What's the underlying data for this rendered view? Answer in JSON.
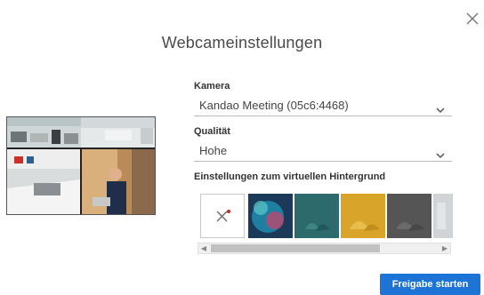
{
  "dialog": {
    "title": "Webcameinstellungen",
    "close_icon": "close-icon"
  },
  "camera": {
    "label": "Kamera",
    "selected": "Kandao Meeting (05c6:4468)"
  },
  "quality": {
    "label": "Qualität",
    "selected": "Hohe"
  },
  "background": {
    "label": "Einstellungen zum virtuellen Hintergrund",
    "options": [
      {
        "name": "none",
        "icon": "no-background-icon"
      },
      {
        "name": "blue-abstract",
        "color": "#1f6f8f"
      },
      {
        "name": "teal-plant",
        "color": "#2f6f6f"
      },
      {
        "name": "yellow-plant",
        "color": "#d8a52a"
      },
      {
        "name": "gray-plant",
        "color": "#5a5a5a"
      },
      {
        "name": "light-partial",
        "color": "#cfd3d6"
      }
    ]
  },
  "actions": {
    "start_label": "Freigabe starten"
  },
  "colors": {
    "accent": "#1e73d6"
  }
}
